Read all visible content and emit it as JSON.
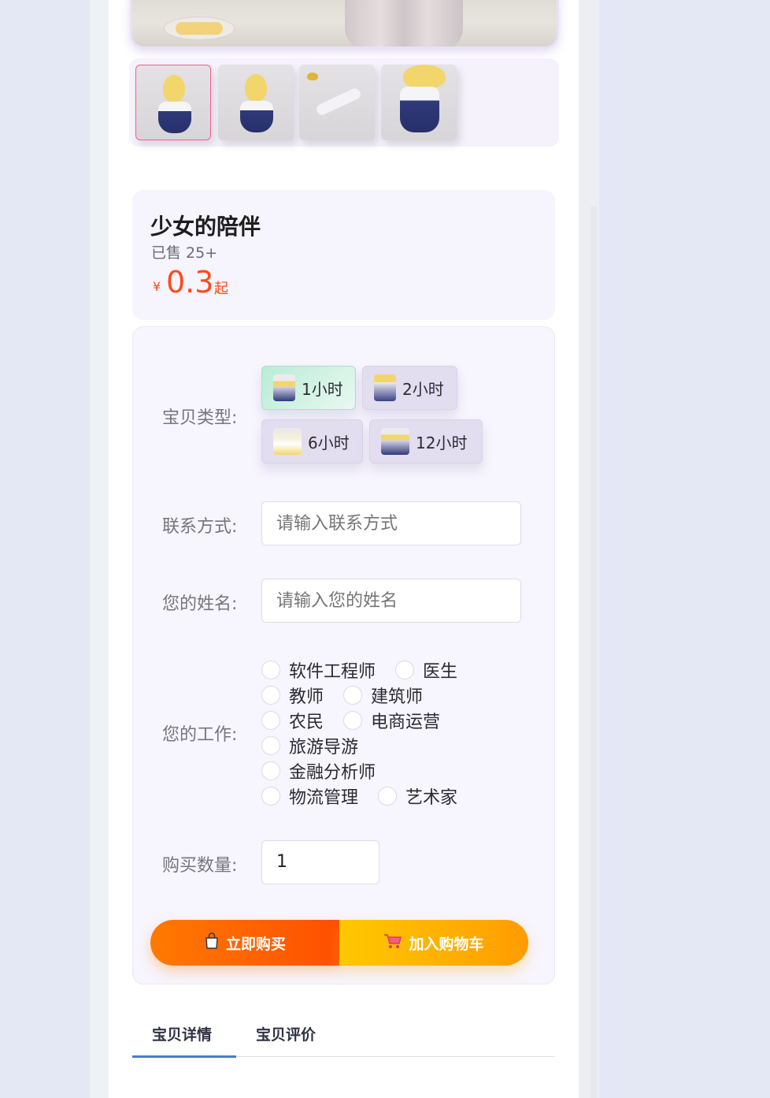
{
  "gallery": {
    "thumbnails": [
      {
        "name": "thumb-1",
        "active": true
      },
      {
        "name": "thumb-2",
        "active": false
      },
      {
        "name": "thumb-3",
        "active": false
      },
      {
        "name": "thumb-4",
        "active": false
      }
    ]
  },
  "product": {
    "title": "少女的陪伴",
    "sold": "已售 25+",
    "currency_symbol": "¥",
    "price": "0.3",
    "price_suffix": "起"
  },
  "form": {
    "sku_label": "宝贝类型:",
    "sku_options": [
      "1小时",
      "2小时",
      "6小时",
      "12小时"
    ],
    "sku_selected": "1小时",
    "contact_label": "联系方式:",
    "contact_placeholder": "请输入联系方式",
    "name_label": "您的姓名:",
    "name_placeholder": "请输入您的姓名",
    "job_label": "您的工作:",
    "job_rows": [
      [
        "软件工程师",
        "医生"
      ],
      [
        "教师",
        "建筑师"
      ],
      [
        "农民",
        "电商运营"
      ],
      [
        "旅游导游"
      ],
      [
        "金融分析师"
      ],
      [
        "物流管理",
        "艺术家"
      ]
    ],
    "quantity_label": "购买数量:",
    "quantity_value": "1"
  },
  "actions": {
    "buy_label": "立即购买",
    "cart_label": "加入购物车",
    "buy_icon": "shopping-bag-icon",
    "cart_icon": "shopping-cart-icon"
  },
  "tabs": {
    "details": "宝贝详情",
    "reviews": "宝贝评价",
    "active": "宝贝详情"
  },
  "colors": {
    "price": "#ff4a1c",
    "buy_start": "#ff7a00",
    "buy_end": "#ff4f00",
    "cart_start": "#ffc800",
    "cart_end": "#ff9c00",
    "tab_active": "#4a7bd0"
  }
}
